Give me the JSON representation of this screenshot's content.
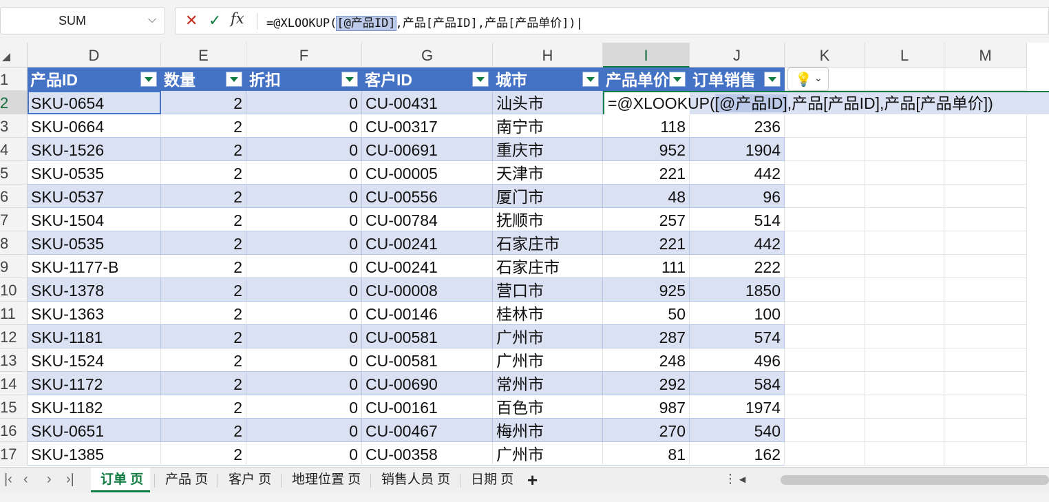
{
  "name_box": {
    "value": "SUM"
  },
  "formula_bar": {
    "formula_pre": "=@XLOOKUP(",
    "formula_ref": "[@产品ID]",
    "formula_post": ",产品[产品ID],产品[产品单价])|"
  },
  "columns": [
    "D",
    "E",
    "F",
    "G",
    "H",
    "I",
    "J",
    "K",
    "L",
    "M"
  ],
  "table_headers": [
    "产品ID",
    "数量",
    "折扣",
    "客户ID",
    "城市",
    "产品单价",
    "订单销售"
  ],
  "rows": [
    {
      "n": "2",
      "id": "SKU-0654",
      "qty": "2",
      "disc": "0",
      "cust": "CU-00431",
      "city": "汕头市",
      "price": "",
      "sales": ""
    },
    {
      "n": "3",
      "id": "SKU-0664",
      "qty": "2",
      "disc": "0",
      "cust": "CU-00317",
      "city": "南宁市",
      "price": "118",
      "sales": "236"
    },
    {
      "n": "4",
      "id": "SKU-1526",
      "qty": "2",
      "disc": "0",
      "cust": "CU-00691",
      "city": "重庆市",
      "price": "952",
      "sales": "1904"
    },
    {
      "n": "5",
      "id": "SKU-0535",
      "qty": "2",
      "disc": "0",
      "cust": "CU-00005",
      "city": "天津市",
      "price": "221",
      "sales": "442"
    },
    {
      "n": "6",
      "id": "SKU-0537",
      "qty": "2",
      "disc": "0",
      "cust": "CU-00556",
      "city": "厦门市",
      "price": "48",
      "sales": "96"
    },
    {
      "n": "7",
      "id": "SKU-1504",
      "qty": "2",
      "disc": "0",
      "cust": "CU-00784",
      "city": "抚顺市",
      "price": "257",
      "sales": "514"
    },
    {
      "n": "8",
      "id": "SKU-0535",
      "qty": "2",
      "disc": "0",
      "cust": "CU-00241",
      "city": "石家庄市",
      "price": "221",
      "sales": "442"
    },
    {
      "n": "9",
      "id": "SKU-1177-B",
      "qty": "2",
      "disc": "0",
      "cust": "CU-00241",
      "city": "石家庄市",
      "price": "111",
      "sales": "222"
    },
    {
      "n": "10",
      "id": "SKU-1378",
      "qty": "2",
      "disc": "0",
      "cust": "CU-00008",
      "city": "营口市",
      "price": "925",
      "sales": "1850"
    },
    {
      "n": "11",
      "id": "SKU-1363",
      "qty": "2",
      "disc": "0",
      "cust": "CU-00146",
      "city": "桂林市",
      "price": "50",
      "sales": "100"
    },
    {
      "n": "12",
      "id": "SKU-1181",
      "qty": "2",
      "disc": "0",
      "cust": "CU-00581",
      "city": "广州市",
      "price": "287",
      "sales": "574"
    },
    {
      "n": "13",
      "id": "SKU-1524",
      "qty": "2",
      "disc": "0",
      "cust": "CU-00581",
      "city": "广州市",
      "price": "248",
      "sales": "496"
    },
    {
      "n": "14",
      "id": "SKU-1172",
      "qty": "2",
      "disc": "0",
      "cust": "CU-00690",
      "city": "常州市",
      "price": "292",
      "sales": "584"
    },
    {
      "n": "15",
      "id": "SKU-1182",
      "qty": "2",
      "disc": "0",
      "cust": "CU-00161",
      "city": "百色市",
      "price": "987",
      "sales": "1974"
    },
    {
      "n": "16",
      "id": "SKU-0651",
      "qty": "2",
      "disc": "0",
      "cust": "CU-00467",
      "city": "梅州市",
      "price": "270",
      "sales": "540"
    },
    {
      "n": "17",
      "id": "SKU-1385",
      "qty": "2",
      "disc": "0",
      "cust": "CU-00358",
      "city": "广州市",
      "price": "81",
      "sales": "162"
    }
  ],
  "header_row_number": "1",
  "edit_cell": {
    "pre": "=@XLOOKUP(",
    "ref": "[@产品ID]",
    "post": ",产品[产品ID],产品[产品单价])"
  },
  "sheet_tabs": [
    "订单 页",
    "产品 页",
    "客户 页",
    "地理位置 页",
    "销售人员 页",
    "日期 页"
  ],
  "active_tab": 0,
  "colors": {
    "accent": "#107c41",
    "table_header": "#4472c4",
    "band": "#d9e1f2"
  }
}
